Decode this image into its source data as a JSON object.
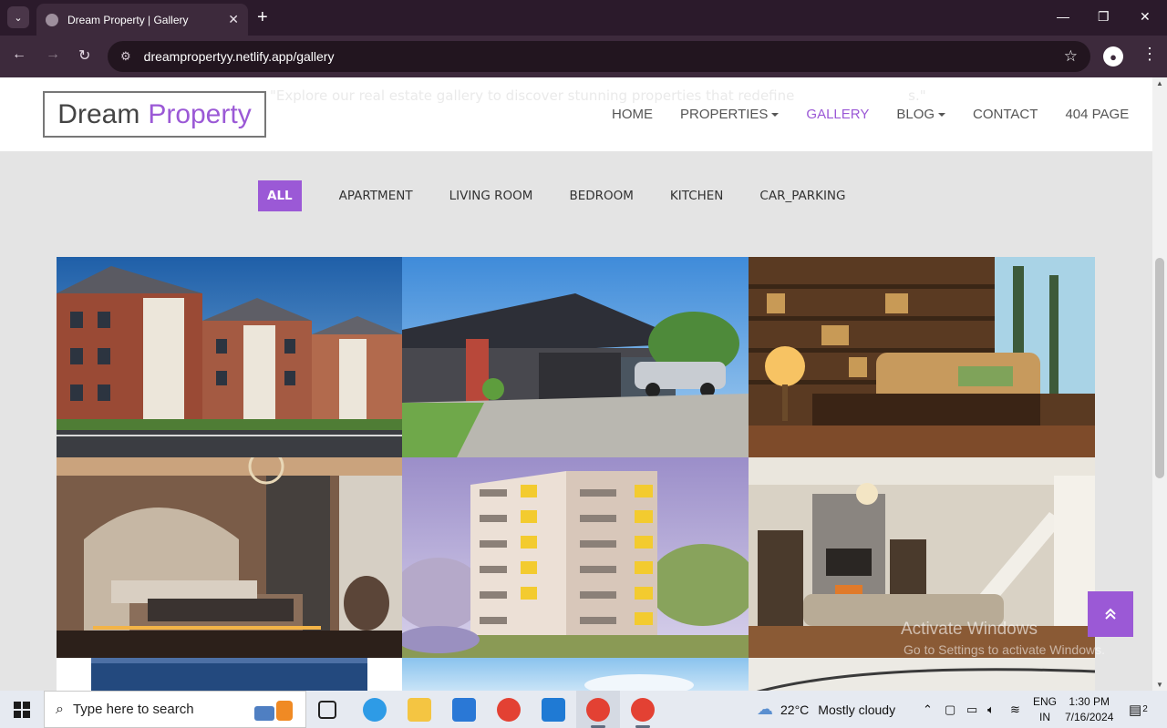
{
  "browser": {
    "tab_title": "Dream Property | Gallery",
    "url": "dreampropertyy.netlify.app/gallery"
  },
  "site": {
    "logo_part1": "Dream",
    "logo_part2": "Property",
    "ghost_text": "\"Explore our real estate gallery to discover stunning properties that redefine",
    "ghost_text_end": "s.\"",
    "nav": [
      {
        "label": "HOME"
      },
      {
        "label": "PROPERTIES"
      },
      {
        "label": "GALLERY"
      },
      {
        "label": "BLOG"
      },
      {
        "label": "CONTACT"
      },
      {
        "label": "404 PAGE"
      }
    ],
    "accent_color": "#9b59d6"
  },
  "filters": [
    "ALL",
    "APARTMENT",
    "LIVING ROOM",
    "BEDROOM",
    "KITCHEN",
    "CAR_PARKING"
  ],
  "gallery": [
    {
      "subject": "apartment-complex"
    },
    {
      "subject": "house-with-driveway"
    },
    {
      "subject": "living-room-bookshelves"
    },
    {
      "subject": "bedroom"
    },
    {
      "subject": "apartment-tower"
    },
    {
      "subject": "living-room-fireplace"
    },
    {
      "subject": "car"
    },
    {
      "subject": "sky"
    },
    {
      "subject": "interior"
    }
  ],
  "watermark": {
    "line1": "Activate Windows",
    "line2": "Go to Settings to activate Windows."
  },
  "taskbar": {
    "search_placeholder": "Type here to search",
    "weather_temp": "22°C",
    "weather_desc": "Mostly cloudy",
    "lang_line1": "ENG",
    "lang_line2": "IN",
    "time": "1:30 PM",
    "date": "7/16/2024",
    "notification_count": "2"
  }
}
